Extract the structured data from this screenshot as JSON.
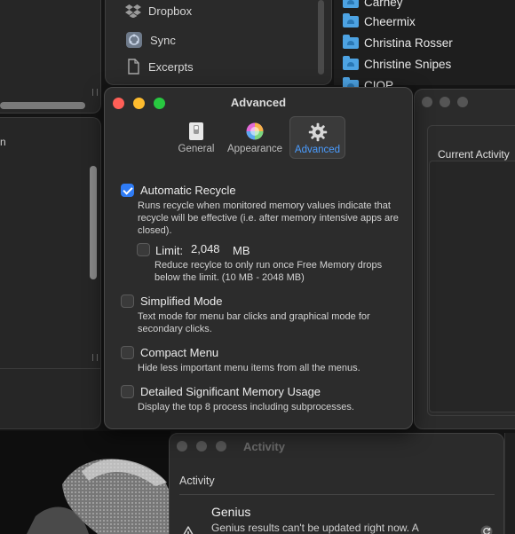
{
  "background": {
    "sidebar_items": [
      {
        "label": "Dropbox",
        "icon": "dropbox-icon"
      },
      {
        "label": "Sync",
        "icon": "sync-icon"
      },
      {
        "label": "Excerpts",
        "icon": "document-icon"
      }
    ],
    "contacts": [
      "Carney",
      "Cheermix",
      "Christina Rosser",
      "Christine Snipes",
      "CIOP"
    ],
    "left_label": "n",
    "current_activity_title": "Current Activity",
    "activity_window": {
      "title": "Activity",
      "section": "Activity",
      "item_title": "Genius",
      "item_desc": "Genius results can't be updated right now. A"
    }
  },
  "dialog": {
    "title": "Advanced",
    "tabs": [
      {
        "label": "General",
        "icon": "switch-icon",
        "active": false
      },
      {
        "label": "Appearance",
        "icon": "color-wheel-icon",
        "active": true
      },
      {
        "label": "Advanced",
        "icon": "gear-icon",
        "active": true
      }
    ],
    "options": {
      "auto_recycle": {
        "title": "Automatic Recycle",
        "checked": true,
        "desc": "Runs recycle when monitored memory values indicate that recycle will be effective (i.e. after memory intensive apps are closed)."
      },
      "limit": {
        "label": "Limit:",
        "value": "2,048",
        "unit": "MB",
        "checked": false,
        "desc": "Reduce recylce to only run once Free Memory drops below the limit. (10 MB - 2048 MB)"
      },
      "simplified_mode": {
        "title": "Simplified Mode",
        "checked": false,
        "desc": "Text mode for menu bar clicks and graphical mode for secondary clicks."
      },
      "compact_menu": {
        "title": "Compact Menu",
        "checked": false,
        "desc": "Hide less important menu items from all the menus."
      },
      "detailed_memory": {
        "title": "Detailed Significant Memory Usage",
        "checked": false,
        "desc": "Display the top 8 process including subprocesses."
      }
    }
  },
  "colors": {
    "accent": "#2f7cf6",
    "active_tab_text": "#4a9cff",
    "traffic_red": "#ff5f57",
    "traffic_yellow": "#febc2e",
    "traffic_green": "#28c840",
    "folder_blue": "#4da3e3"
  }
}
